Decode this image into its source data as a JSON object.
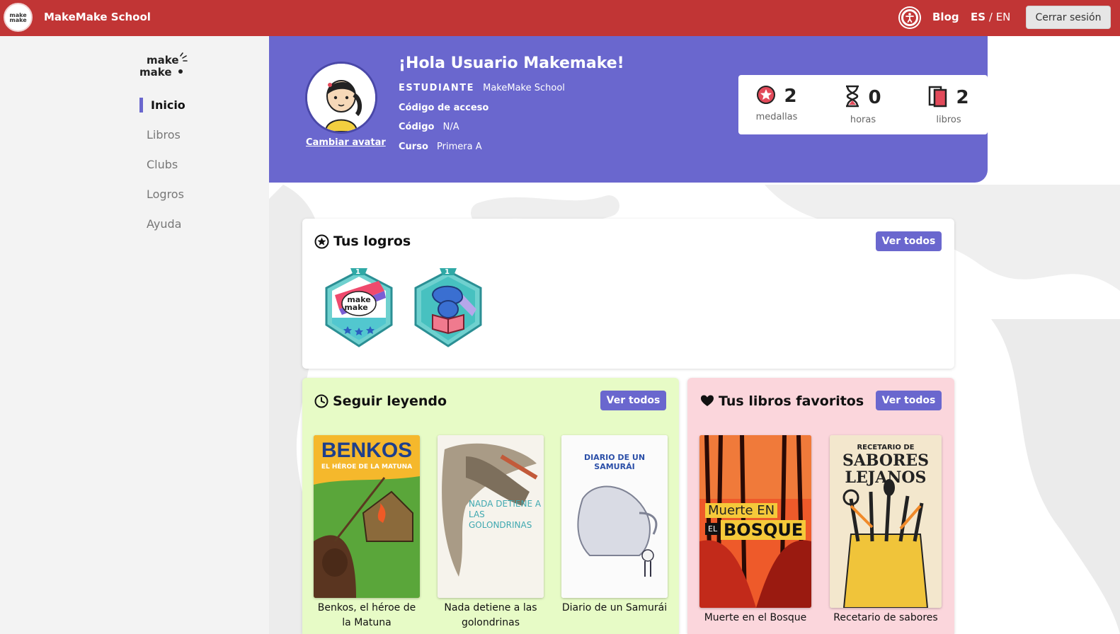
{
  "topbar": {
    "logo_text": "make make",
    "school_name": "MakeMake School",
    "blog": "Blog",
    "lang_es": "ES",
    "lang_sep": "/",
    "lang_en": "EN",
    "logout": "Cerrar sesión"
  },
  "sidebar": {
    "brand": "make make",
    "items": [
      {
        "label": "Inicio",
        "active": true
      },
      {
        "label": "Libros"
      },
      {
        "label": "Clubs"
      },
      {
        "label": "Logros"
      },
      {
        "label": "Ayuda"
      }
    ]
  },
  "profile": {
    "greeting": "¡Hola Usuario Makemake!",
    "change_avatar": "Cambiar avatar",
    "role_label": "ESTUDIANTE",
    "role_value": "MakeMake School",
    "access_code_label": "Código de acceso",
    "code_label": "Código",
    "code_value": "N/A",
    "course_label": "Curso",
    "course_value": "Primera A",
    "stats": [
      {
        "value": "2",
        "label": "medallas",
        "icon": "medal-icon"
      },
      {
        "value": "0",
        "label": "horas",
        "icon": "hourglass-icon"
      },
      {
        "value": "2",
        "label": "libros",
        "icon": "books-icon"
      }
    ]
  },
  "achievements": {
    "title": "Tus logros",
    "see_all": "Ver todos",
    "badges": [
      {
        "level": "1",
        "text": "make make"
      },
      {
        "level": "1",
        "text": ""
      }
    ]
  },
  "continue_reading": {
    "title": "Seguir leyendo",
    "see_all": "Ver todos",
    "books": [
      {
        "title_line1": "Benkos, el héroe de",
        "title_line2": "la Matuna",
        "cover_title": "BENKOS",
        "cover_subtitle": "EL HÉROE DE LA MATUNA"
      },
      {
        "title_line1": "Nada detiene a las",
        "title_line2": "golondrinas",
        "cover_title": "NADA DETIENE A LAS GOLONDRINAS",
        "cover_subtitle": ""
      },
      {
        "title_line1": "Diario de un Samurái",
        "title_line2": "",
        "cover_title": "DIARIO DE UN SAMURÁI",
        "cover_subtitle": ""
      }
    ]
  },
  "favorites": {
    "title": "Tus libros favoritos",
    "see_all": "Ver todos",
    "books": [
      {
        "title_line1": "Muerte en el Bosque",
        "cover_title_top": "Muerte EN",
        "cover_el": "EL",
        "cover_title": "BOSQUE"
      },
      {
        "title_line1": "Recetario de sabores",
        "cover_title_top": "RECETARIO DE",
        "cover_title": "SABORES LEJANOS"
      }
    ]
  },
  "colors": {
    "topbar": "#c13535",
    "accent": "#6a67ce",
    "continue_bg": "#e7fbc6",
    "favorites_bg": "#fbd6dc"
  }
}
